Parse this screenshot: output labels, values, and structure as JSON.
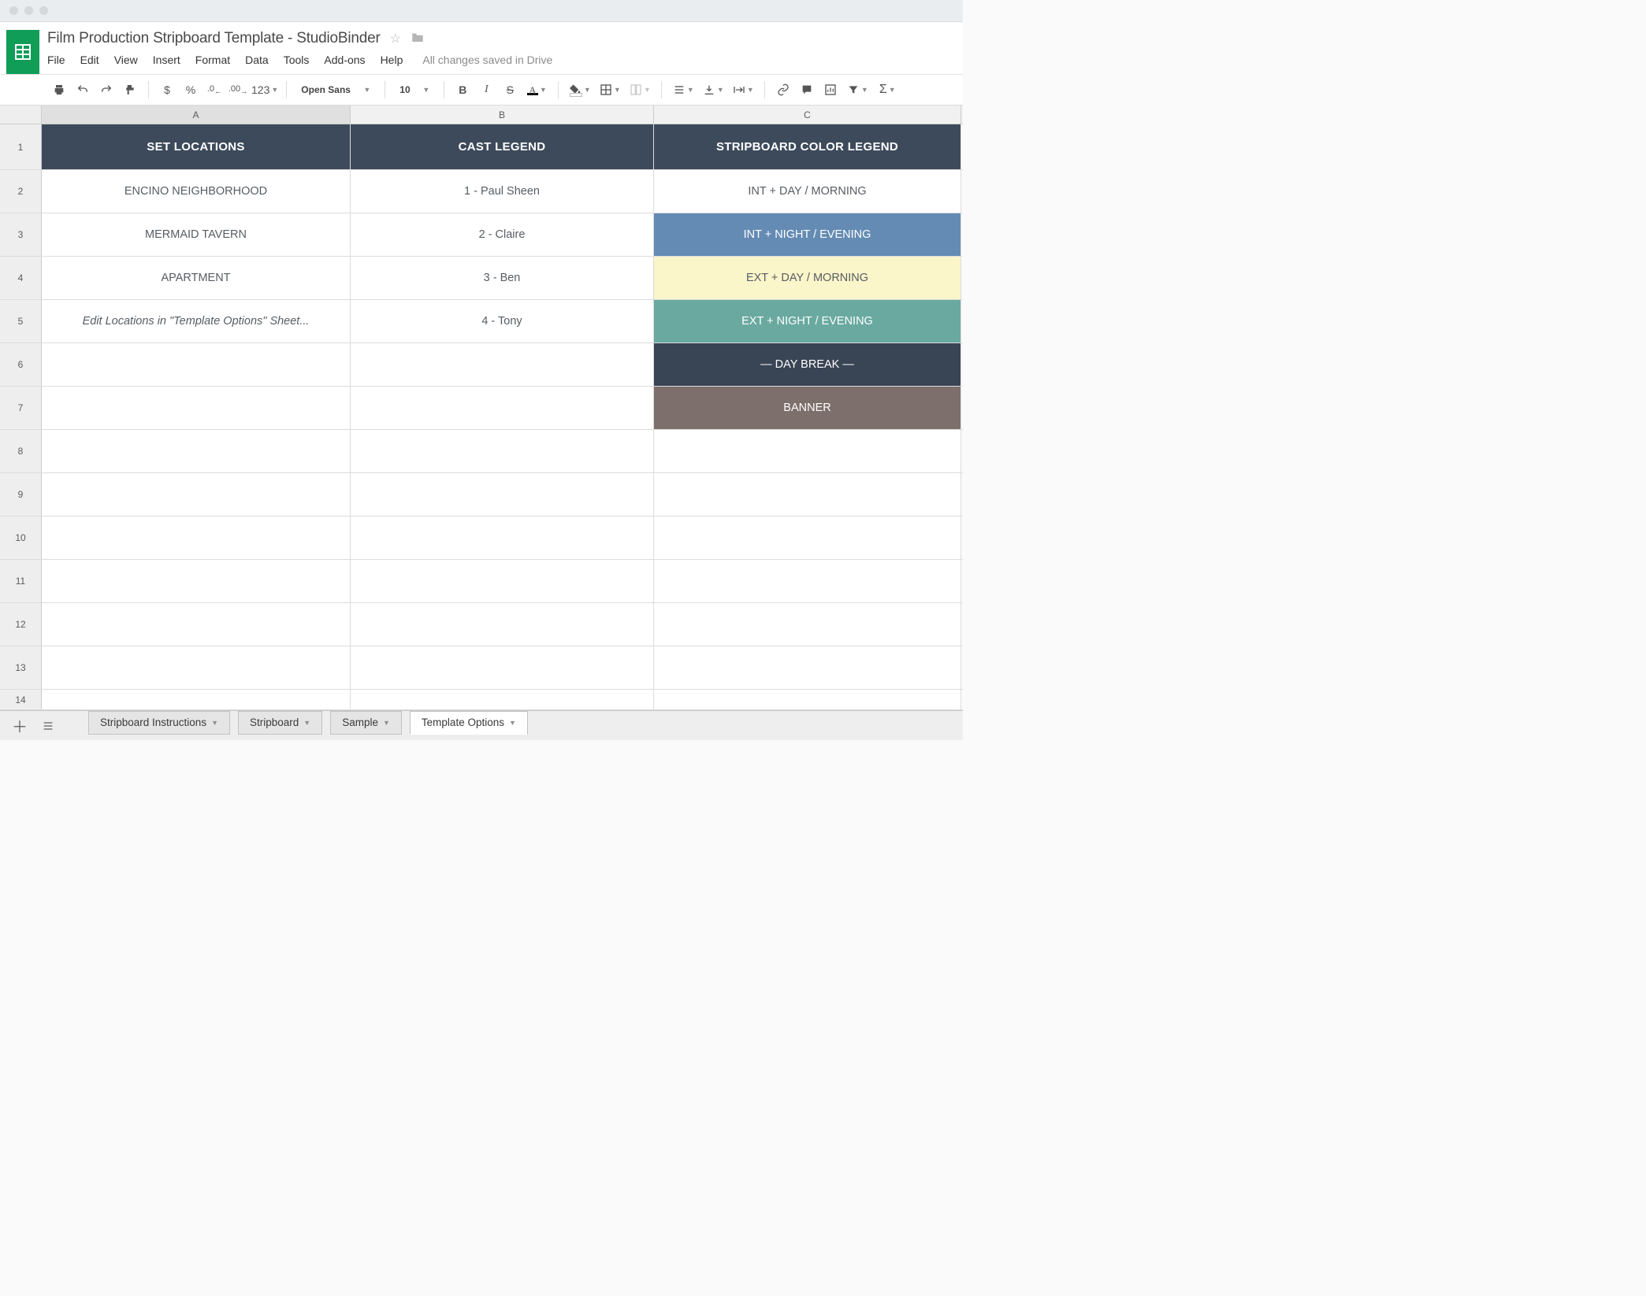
{
  "doc": {
    "title": "Film Production Stripboard Template  -  StudioBinder",
    "save_status": "All changes saved in Drive"
  },
  "menu": {
    "file": "File",
    "edit": "Edit",
    "view": "View",
    "insert": "Insert",
    "format": "Format",
    "data": "Data",
    "tools": "Tools",
    "addons": "Add-ons",
    "help": "Help"
  },
  "toolbar": {
    "format_currency": "$",
    "format_percent": "%",
    "format_dec_dec": ".0",
    "format_dec_inc": ".00",
    "format_more": "123",
    "font_name": "Open Sans",
    "font_size": "10",
    "bold": "B",
    "italic": "I",
    "strike": "S",
    "text_color": "A"
  },
  "columns": {
    "a": "A",
    "b": "B",
    "c": "C"
  },
  "rows": [
    "1",
    "2",
    "3",
    "4",
    "5",
    "6",
    "7",
    "8",
    "9",
    "10",
    "11",
    "12",
    "13",
    "14"
  ],
  "headers": {
    "a": "SET LOCATIONS",
    "b": "CAST LEGEND",
    "c": "STRIPBOARD COLOR LEGEND"
  },
  "locations": {
    "r2": "ENCINO NEIGHBORHOOD",
    "r3": "MERMAID TAVERN",
    "r4": "APARTMENT",
    "r5": "Edit Locations in \"Template Options\" Sheet..."
  },
  "cast": {
    "r2": "1 - Paul Sheen",
    "r3": "2 - Claire",
    "r4": "3 - Ben",
    "r5": "4 - Tony"
  },
  "legend": {
    "r2": {
      "label": "INT  +  DAY / MORNING"
    },
    "r3": {
      "label": "INT  +  NIGHT / EVENING"
    },
    "r4": {
      "label": "EXT  +  DAY / MORNING"
    },
    "r5": {
      "label": "EXT  +  NIGHT / EVENING"
    },
    "r6": {
      "label": "— DAY BREAK —"
    },
    "r7": {
      "label": "BANNER"
    }
  },
  "legend_colors": {
    "r2": "#ffffff",
    "r3": "#648bb3",
    "r4": "#fbf5ca",
    "r5": "#6aa9a0",
    "r6": "#394454",
    "r7": "#7d6f6c"
  },
  "row_heights": {
    "header": 58,
    "data": 55,
    "last": 26
  },
  "sheet_tabs": {
    "t1": "Stripboard Instructions",
    "t2": "Stripboard",
    "t3": "Sample",
    "t4": "Template Options"
  }
}
